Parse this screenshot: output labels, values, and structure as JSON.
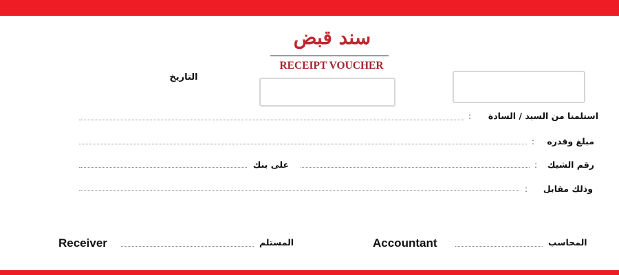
{
  "header": {
    "title_ar": "سند قبض",
    "title_en": "RECEIPT VOUCHER"
  },
  "date": {
    "label": "التاريخ"
  },
  "fields": {
    "received_from": "استلمنا من السيد /  السادة",
    "amount": "مبلغ وقدره",
    "cheque_no": "رقم الشيك",
    "bank": "على بنك",
    "against": "وذلك مقابل",
    "colon": ":"
  },
  "signatures": {
    "receiver_en": "Receiver",
    "receiver_ar": "المستلم",
    "accountant_en": "Accountant",
    "accountant_ar": "المحاسب"
  },
  "colors": {
    "brand_red": "#ee1c25",
    "title_red": "#c0272d"
  }
}
